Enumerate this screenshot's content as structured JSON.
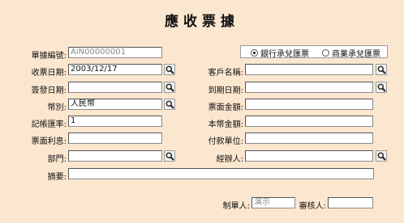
{
  "title": "應收票據",
  "fields": {
    "bill_no": {
      "label": "單據編號:",
      "value": "AiN00000001"
    },
    "receive_date": {
      "label": "收票日期:",
      "value": "2003/12/17"
    },
    "sign_date": {
      "label": "簽發日期:",
      "value": ""
    },
    "currency": {
      "label": "幣別:",
      "value": "人民幣"
    },
    "rate": {
      "label": "記帳匯率:",
      "value": "1"
    },
    "interest": {
      "label": "票面利息:",
      "value": ""
    },
    "department": {
      "label": "部門:",
      "value": ""
    },
    "summary": {
      "label": "摘要:",
      "value": ""
    },
    "customer": {
      "label": "客戶名稱:",
      "value": ""
    },
    "due_date": {
      "label": "到期日期:",
      "value": ""
    },
    "face_amount": {
      "label": "票面金額:",
      "value": ""
    },
    "local_amount": {
      "label": "本幣金額:",
      "value": ""
    },
    "payer_unit": {
      "label": "付款單位:",
      "value": ""
    },
    "handler": {
      "label": "經辦人:",
      "value": ""
    },
    "maker": {
      "label": "制單人:",
      "value": "演示"
    },
    "auditor": {
      "label": "審核人:",
      "value": ""
    }
  },
  "bill_type": {
    "options": [
      "銀行承兌匯票",
      "商業承兌匯票"
    ],
    "selected": "銀行承兌匯票"
  },
  "icons": {
    "lookup": "magnifier-icon"
  }
}
